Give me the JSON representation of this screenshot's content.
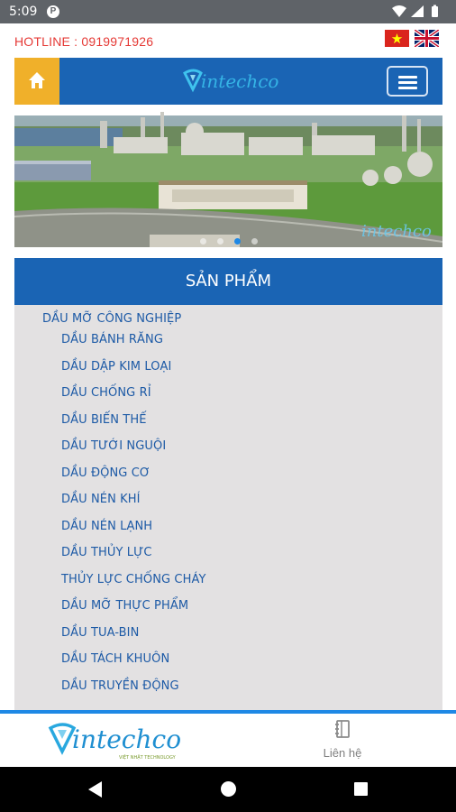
{
  "status_bar": {
    "time": "5:09",
    "notification_glyph": "P"
  },
  "top_bar": {
    "hotline": "HOTLINE : 0919971926",
    "languages": [
      "vi",
      "en"
    ]
  },
  "header": {
    "logo_text": "intechco",
    "icons": [
      "home-icon",
      "hamburger-menu-icon"
    ]
  },
  "banner": {
    "slide_count": 4,
    "active_slide": 3,
    "watermark_text": "intechco"
  },
  "products": {
    "heading": "SẢN PHẨM",
    "category": "DẦU MỠ CÔNG NGHIỆP",
    "items": [
      "DẦU BÁNH RĂNG",
      "DẦU DẬP KIM LOẠI",
      "DẦU CHỐNG RỈ",
      "DẦU BIẾN THẾ",
      "DẦU TƯỚI NGUỘI",
      "DẦU ĐỘNG CƠ",
      "DẦU NÉN KHÍ",
      "DẦU NÉN LẠNH",
      "DẦU THỦY LỰC",
      "THỦY LỰC CHỐNG CHÁY",
      "DẦU MỠ THỰC PHẨM",
      "DẦU TUA-BIN",
      "DẦU TÁCH KHUÔN",
      "DẦU TRUYỀN ĐỘNG"
    ]
  },
  "bottom_nav": {
    "logo_text": "intechco",
    "logo_tagline": "VIỆT NHẬT TECHNOLOGY",
    "contact_label": "Liên hệ"
  },
  "colors": {
    "primary_blue": "#1a64b4",
    "home_yellow": "#f0b02a",
    "hotline_red": "#e53935",
    "list_background": "#e3e1e2",
    "link_blue": "#1d5aa6"
  }
}
